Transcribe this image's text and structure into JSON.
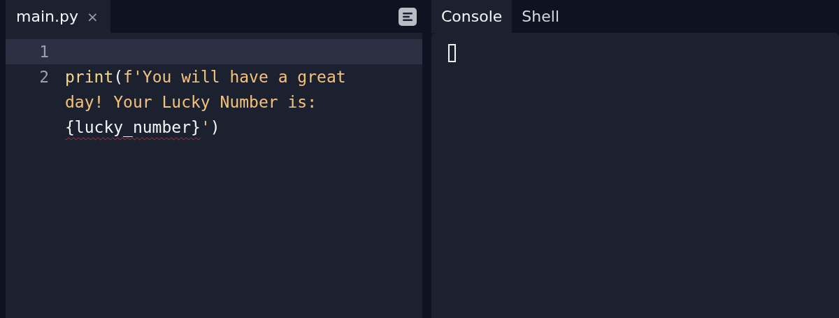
{
  "editor": {
    "tabs": [
      {
        "label": "main.py",
        "close": "×",
        "selected": true
      }
    ],
    "lines": [
      {
        "number": "1",
        "current": true
      },
      {
        "number": "2",
        "current": false,
        "tokens": [
          {
            "kind": "function",
            "text": "print"
          },
          {
            "kind": "punct",
            "text": "("
          },
          {
            "kind": "string",
            "text": "f'You will have a great day! Your Lucky Number is: "
          },
          {
            "kind": "error",
            "text": "{lucky_number}"
          },
          {
            "kind": "string",
            "text": "'"
          },
          {
            "kind": "punct",
            "text": ")"
          }
        ]
      }
    ]
  },
  "console": {
    "tabs": [
      {
        "label": "Console",
        "selected": true
      },
      {
        "label": "Shell",
        "selected": false
      }
    ]
  }
}
